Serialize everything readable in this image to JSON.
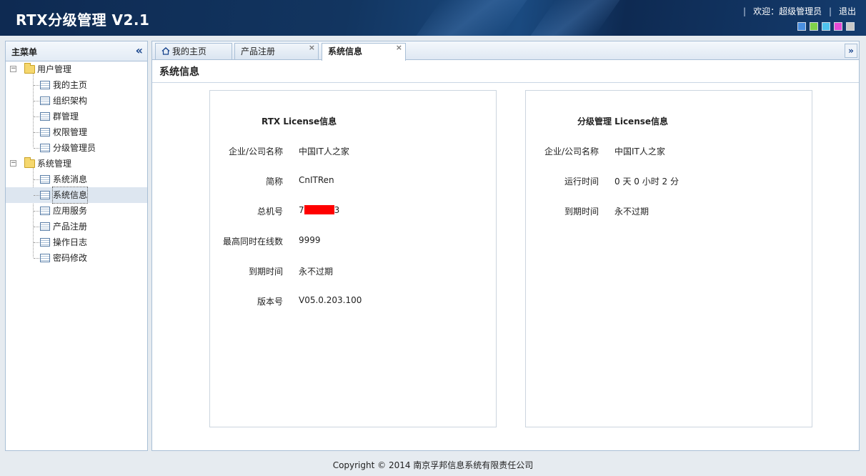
{
  "header": {
    "title": "RTX分级管理  V2.1",
    "welcome_text": "欢迎：超级管理员",
    "logout_label": "退出",
    "theme_colors": [
      "#4a8fe0",
      "#7fd24a",
      "#4fc3ee",
      "#e64ad6",
      "#c8c8c8"
    ]
  },
  "sidebar": {
    "title": "主菜单",
    "collapse_icon": "double-chevron-left-icon",
    "groups": [
      {
        "label": "用户管理",
        "items": [
          "我的主页",
          "组织架构",
          "群管理",
          "权限管理",
          "分级管理员"
        ]
      },
      {
        "label": "系统管理",
        "items": [
          "系统消息",
          "系统信息",
          "应用服务",
          "产品注册",
          "操作日志",
          "密码修改"
        ]
      }
    ],
    "selected_item": "系统信息"
  },
  "tabs": [
    {
      "label": "我的主页",
      "icon": "home-icon"
    },
    {
      "label": "产品注册"
    },
    {
      "label": "系统信息"
    }
  ],
  "main": {
    "page_title": "系统信息",
    "rtx_card": {
      "title": "RTX License信息",
      "rows": [
        {
          "label": "企业/公司名称",
          "value": "中国IT人之家"
        },
        {
          "label": "简称",
          "value": "CnITRen"
        },
        {
          "label": "总机号",
          "value_prefix": "7",
          "value_suffix": "3"
        },
        {
          "label": "最高同时在线数",
          "value": "9999"
        },
        {
          "label": "到期时间",
          "value": "永不过期"
        },
        {
          "label": "版本号",
          "value": "V05.0.203.100"
        }
      ]
    },
    "grade_card": {
      "title": "分级管理  License信息",
      "rows": [
        {
          "label": "企业/公司名称",
          "value": "中国IT人之家"
        },
        {
          "label": "运行时间",
          "value": "0 天  0 小时  2 分"
        },
        {
          "label": "到期时间",
          "value": "永不过期"
        }
      ]
    }
  },
  "footer": {
    "copyright": "Copyright © 2014 南京孚邦信息系统有限责任公司"
  }
}
